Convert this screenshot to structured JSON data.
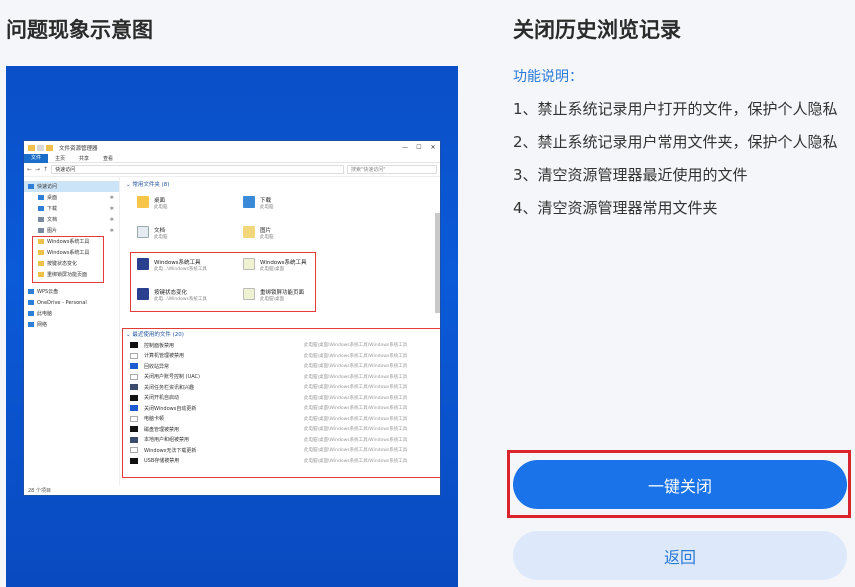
{
  "left_panel": {
    "title": "问题现象示意图"
  },
  "explorer": {
    "window_title": "文件资源管理器",
    "ribbon_tabs": [
      "文件",
      "主页",
      "共享",
      "查看"
    ],
    "address": "快速访问",
    "search_placeholder": "搜索\"快速访问\"",
    "sidebar": [
      {
        "label": "快速访问"
      },
      {
        "label": "桌面"
      },
      {
        "label": "下载"
      },
      {
        "label": "文档"
      },
      {
        "label": "图片"
      },
      {
        "label": "Windows系统工具"
      },
      {
        "label": "Windows系统工具"
      },
      {
        "label": "按键状态变化"
      },
      {
        "label": "重绑锁屏功能页面"
      },
      {
        "label": "WPS云盘"
      },
      {
        "label": "OneDrive - Personal"
      },
      {
        "label": "此电脑"
      },
      {
        "label": "网络"
      }
    ],
    "frequent_header": "常用文件夹 (8)",
    "frequent": [
      {
        "name": "桌面",
        "sub": "此电脑"
      },
      {
        "name": "下载",
        "sub": "此电脑"
      },
      {
        "name": "文档",
        "sub": "此电脑"
      },
      {
        "name": "图片",
        "sub": "此电脑"
      },
      {
        "name": "Windows系统工具",
        "sub": "此电...\\Windows系统工具"
      },
      {
        "name": "Windows系统工具",
        "sub": "此电脑\\桌面"
      },
      {
        "name": "按键状态变化",
        "sub": "此电...\\Windows系统工具"
      },
      {
        "name": "重绑锁屏功能页面",
        "sub": "此电脑\\桌面"
      }
    ],
    "recent_header": "最近使用的文件 (20)",
    "recent": [
      {
        "name": "控制面板禁用",
        "loc": "此电脑\\桌面\\Windows系统工具\\Windows系统工具"
      },
      {
        "name": "计算机管理被禁用",
        "loc": "此电脑\\桌面\\Windows系统工具\\Windows系统工具"
      },
      {
        "name": "回收站异常",
        "loc": "此电脑\\桌面\\Windows系统工具\\Windows系统工具"
      },
      {
        "name": "关闭用户账号控制 (UAC)",
        "loc": "此电脑\\桌面\\Windows系统工具\\Windows系统工具"
      },
      {
        "name": "关闭任务栏资讯和兴趣",
        "loc": "此电脑\\桌面\\Windows系统工具\\Windows系统工具"
      },
      {
        "name": "关闭开机自启动",
        "loc": "此电脑\\桌面\\Windows系统工具\\Windows系统工具"
      },
      {
        "name": "关闭Windows自动更新",
        "loc": "此电脑\\桌面\\Windows系统工具\\Windows系统工具"
      },
      {
        "name": "电脑卡顿",
        "loc": "此电脑\\桌面\\Windows系统工具\\Windows系统工具"
      },
      {
        "name": "磁盘管理被禁用",
        "loc": "此电脑\\桌面\\Windows系统工具\\Windows系统工具"
      },
      {
        "name": "本地用户和组被禁用",
        "loc": "此电脑\\桌面\\Windows系统工具\\Windows系统工具"
      },
      {
        "name": "Windows无法下载更新",
        "loc": "此电脑\\桌面\\Windows系统工具\\Windows系统工具"
      },
      {
        "name": "USB存储被禁用",
        "loc": "此电脑\\桌面\\Windows系统工具\\Windows系统工具"
      }
    ],
    "status": "28 个项目"
  },
  "right_panel": {
    "title": "关闭历史浏览记录",
    "desc_label": "功能说明：",
    "items": [
      "1、禁止系统记录用户打开的文件，保护个人隐私",
      "2、禁止系统记录用户常用文件夹，保护个人隐私",
      "3、清空资源管理器最近使用的文件",
      "4、清空资源管理器常用文件夹"
    ],
    "primary_button": "一键关闭",
    "back_button": "返回"
  },
  "colors": {
    "accent": "#1a73e8",
    "highlight": "#d9242b",
    "preview_bg": "#0a4fc7"
  }
}
